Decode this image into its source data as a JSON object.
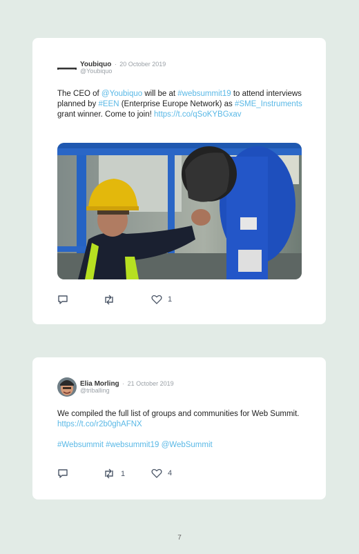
{
  "tweets": [
    {
      "author": "Youbiquo",
      "date": "20 October 2019",
      "separator": "·",
      "handle": "@Youbiquo",
      "text": [
        {
          "t": "The CEO of ",
          "link": false
        },
        {
          "t": "@Youbiquo",
          "link": true
        },
        {
          "t": " will be at ",
          "link": false
        },
        {
          "t": "#websummit19",
          "link": true
        },
        {
          "t": " to attend interviews planned by ",
          "link": false
        },
        {
          "t": "#EEN",
          "link": true
        },
        {
          "t": " (Enterprise Europe Network) as ",
          "link": false
        },
        {
          "t": "#SME_Instruments",
          "link": true
        },
        {
          "t": " grant winner. Come to join! ",
          "link": false
        },
        {
          "t": "https://t.co/qSoKYBGxav",
          "link": true
        }
      ],
      "avatar_icon": "youbiquo-logo-icon",
      "image_icon": "worker-with-robot-photo",
      "actions": {
        "reply_count": "",
        "retweet_count": "",
        "like_count": "1"
      }
    },
    {
      "author": "Elia Morling",
      "date": "21 October 2019",
      "separator": "·",
      "handle": "@triballing",
      "text": [
        {
          "t": "We compiled the full list of groups and communities for Web Summit. ",
          "link": false
        },
        {
          "t": "https://t.co/r2b0ghAFNX",
          "link": true
        }
      ],
      "hashtags": "#Websummit #websummit19 @WebSummit",
      "avatar_icon": "user-avatar-photo",
      "actions": {
        "reply_count": "",
        "retweet_count": "1",
        "like_count": "4"
      }
    }
  ],
  "page_number": "7",
  "colors": {
    "background": "#e2ebe6",
    "link": "#59b8e6",
    "card": "#ffffff"
  }
}
